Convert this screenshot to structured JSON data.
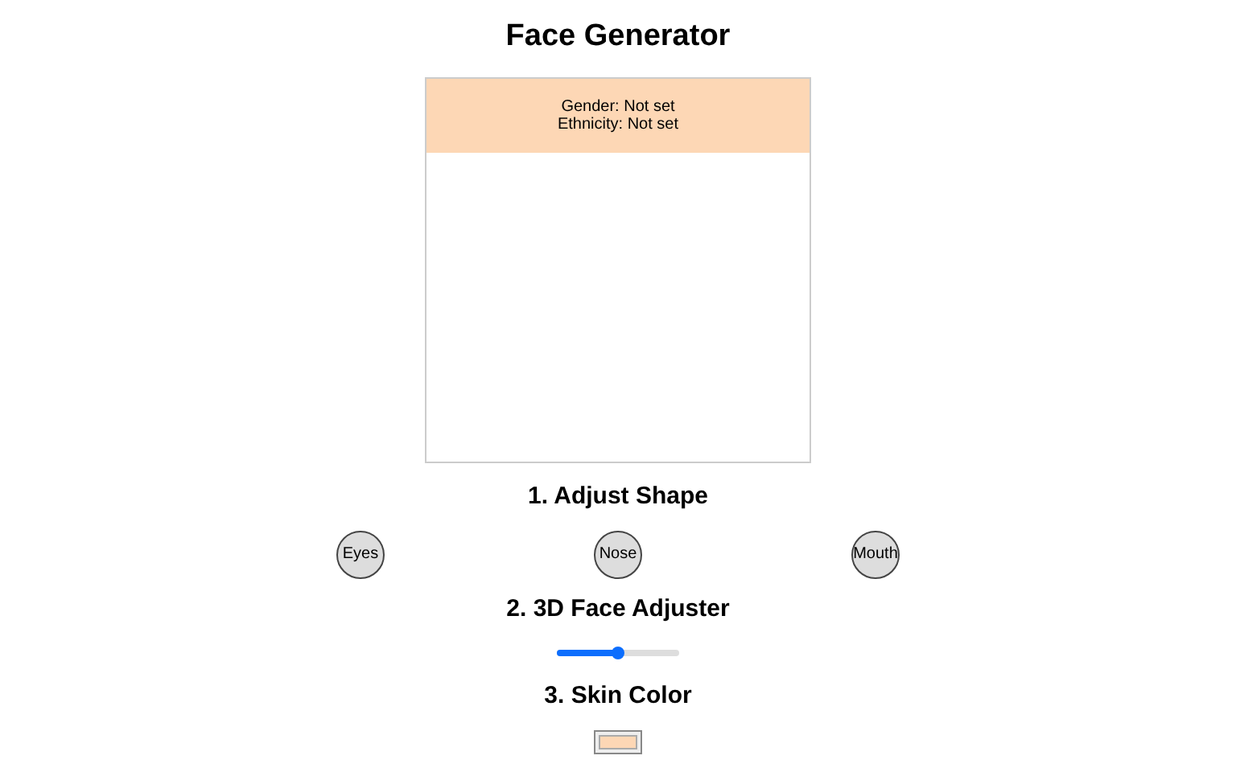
{
  "title": "Face Generator",
  "preview": {
    "info_lines": [
      "Gender: Not set",
      "Ethnicity: Not set"
    ],
    "color": "#fdd7b5"
  },
  "sections": [
    {
      "heading": "1. Adjust Shape",
      "kind": "buttons",
      "buttons": [
        "Eyes",
        "Nose",
        "Mouth"
      ]
    },
    {
      "heading": "2. 3D Face Adjuster",
      "kind": "slider",
      "level": 0.5
    },
    {
      "heading": "3. Skin Color",
      "kind": "color",
      "color": "#fdd7b5"
    }
  ]
}
